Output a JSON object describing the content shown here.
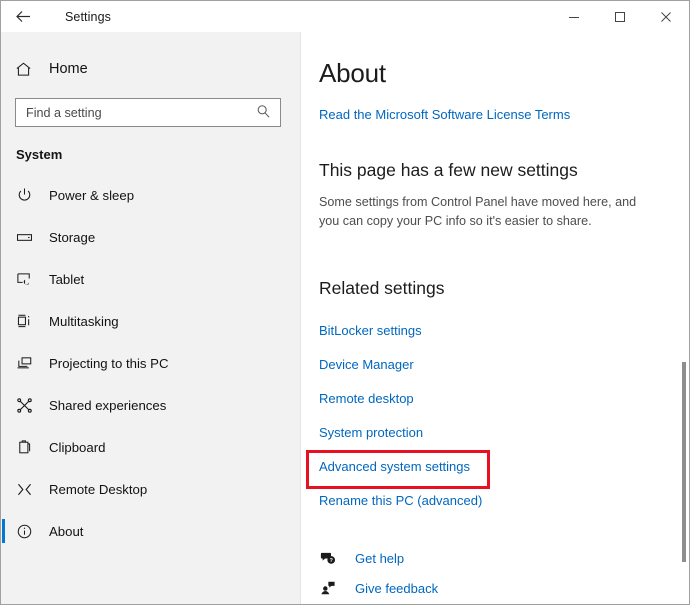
{
  "window": {
    "title": "Settings",
    "back_icon": "back-arrow-icon",
    "controls": {
      "minimize": "minimize-icon",
      "maximize": "maximize-icon",
      "close": "close-icon"
    }
  },
  "sidebar": {
    "home": {
      "label": "Home",
      "icon": "home-icon"
    },
    "search": {
      "placeholder": "Find a setting",
      "value": "",
      "icon": "search-icon"
    },
    "group_title": "System",
    "items": [
      {
        "label": "Power & sleep",
        "icon": "power-icon",
        "selected": false
      },
      {
        "label": "Storage",
        "icon": "storage-icon",
        "selected": false
      },
      {
        "label": "Tablet",
        "icon": "tablet-icon",
        "selected": false
      },
      {
        "label": "Multitasking",
        "icon": "multitasking-icon",
        "selected": false
      },
      {
        "label": "Projecting to this PC",
        "icon": "projecting-icon",
        "selected": false
      },
      {
        "label": "Shared experiences",
        "icon": "shared-experiences-icon",
        "selected": false
      },
      {
        "label": "Clipboard",
        "icon": "clipboard-icon",
        "selected": false
      },
      {
        "label": "Remote Desktop",
        "icon": "remote-desktop-icon",
        "selected": false
      },
      {
        "label": "About",
        "icon": "info-icon",
        "selected": true
      }
    ]
  },
  "main": {
    "page_title": "About",
    "license_link": "Read the Microsoft Software License Terms",
    "new_settings_heading": "This page has a few new settings",
    "new_settings_body": "Some settings from Control Panel have moved here, and you can copy your PC info so it's easier to share.",
    "related_heading": "Related settings",
    "related_links": [
      {
        "label": "BitLocker settings",
        "highlighted": false
      },
      {
        "label": "Device Manager",
        "highlighted": false
      },
      {
        "label": "Remote desktop",
        "highlighted": false
      },
      {
        "label": "System protection",
        "highlighted": false
      },
      {
        "label": "Advanced system settings",
        "highlighted": true
      },
      {
        "label": "Rename this PC (advanced)",
        "highlighted": false
      }
    ],
    "help_links": [
      {
        "label": "Get help",
        "icon": "get-help-icon"
      },
      {
        "label": "Give feedback",
        "icon": "give-feedback-icon"
      }
    ]
  },
  "colors": {
    "link": "#0067c0",
    "accent": "#0078d4",
    "highlight_box": "#e81123",
    "sidebar_bg": "#f2f2f2"
  }
}
